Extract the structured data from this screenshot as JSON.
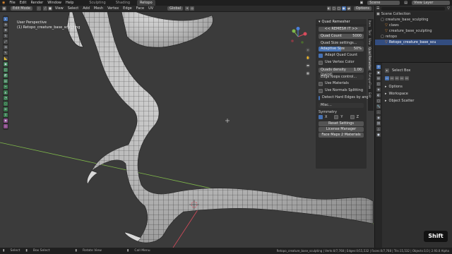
{
  "topbar": {
    "menus": [
      "File",
      "Edit",
      "Render",
      "Window",
      "Help"
    ],
    "workspaces": [
      "Sculpting",
      "Shading",
      "Retopo"
    ],
    "active_workspace": "Retopo",
    "scene": "Scene",
    "view_layer": "View Layer"
  },
  "viewport_header": {
    "mode": "Edit Mode",
    "menus": [
      "View",
      "Select",
      "Add",
      "Mesh",
      "Vertex",
      "Edge",
      "Face",
      "UV"
    ],
    "transform": "Global",
    "options": "Options"
  },
  "viewport": {
    "view_name": "User Perspective",
    "object_name": "(1) Retopo_creature_base_sculpting"
  },
  "quad_remesher": {
    "title": "Quad Remesher",
    "remesh_button": "<< REMESH IT >>",
    "quad_count_label": "Quad Count",
    "quad_count": "5000",
    "quad_size_settings": "Quad Size settings...",
    "adaptive_size_label": "Adaptive Size",
    "adaptive_size_value": "50%",
    "adaptive_size_fill": 0.5,
    "adapt_quad_count": "Adapt Quad Count",
    "use_vertex_color": "Use Vertex Color",
    "quads_density_label": "Quads density (paint)",
    "quads_density_value": "1.00",
    "edge_loops_control": "Edge loops control...",
    "use_materials": "Use Materials",
    "use_normals_splitting": "Use Normals Splitting",
    "detect_hard_edges": "Detect Hard Edges by angle",
    "misc": "Misc...",
    "symmetry_label": "Symmetry",
    "sym_x": "X",
    "sym_y": "Y",
    "sym_z": "Z",
    "reset_settings": "Reset Settings",
    "license_manager": "License Manager",
    "face_maps_button": "Face Maps 2 Materials"
  },
  "sidebar_tabs": [
    "Item",
    "Tool",
    "View",
    "Quad Remesher",
    "RetopoFlow",
    "Edit"
  ],
  "active_sidebar_tab": "Quad Remesher",
  "outliner": {
    "items": [
      {
        "label": "Scene Collection",
        "indent": 0,
        "selected": false,
        "icon": "scene-collection-icon"
      },
      {
        "label": "creature_base_sculpting",
        "indent": 1,
        "selected": false,
        "icon": "collection-icon"
      },
      {
        "label": "claws",
        "indent": 2,
        "selected": false,
        "icon": "mesh-icon"
      },
      {
        "label": "creature_base_sculpting",
        "indent": 2,
        "selected": false,
        "icon": "mesh-icon"
      },
      {
        "label": "retopo",
        "indent": 1,
        "selected": false,
        "icon": "collection-icon"
      },
      {
        "label": "Retopo_creature_base_scu",
        "indent": 2,
        "selected": true,
        "icon": "mesh-icon"
      }
    ]
  },
  "properties": {
    "select_tool": "Select Box",
    "sections": [
      "Options",
      "Workspace",
      "Object Scatter"
    ]
  },
  "statusbar": {
    "hints": [
      "Select",
      "Box Select",
      "Rotate View",
      "Call Menu"
    ],
    "stats": "Retopo_creature_base_sculpting | Verts:0/7,768 | Edges:0/15,532 | Faces:0/7,768 | Tris:15,532 | Objects:1/3 | 2.93.0 Alpha"
  },
  "key_overlay": "Shift",
  "colors": {
    "accent": "#4772b3",
    "panel_bg": "#2e2e2e",
    "viewport_bg": "#3b3b3b",
    "x_axis": "#d94b5c",
    "y_axis": "#7fb84a",
    "z_axis": "#4a7fd9"
  }
}
